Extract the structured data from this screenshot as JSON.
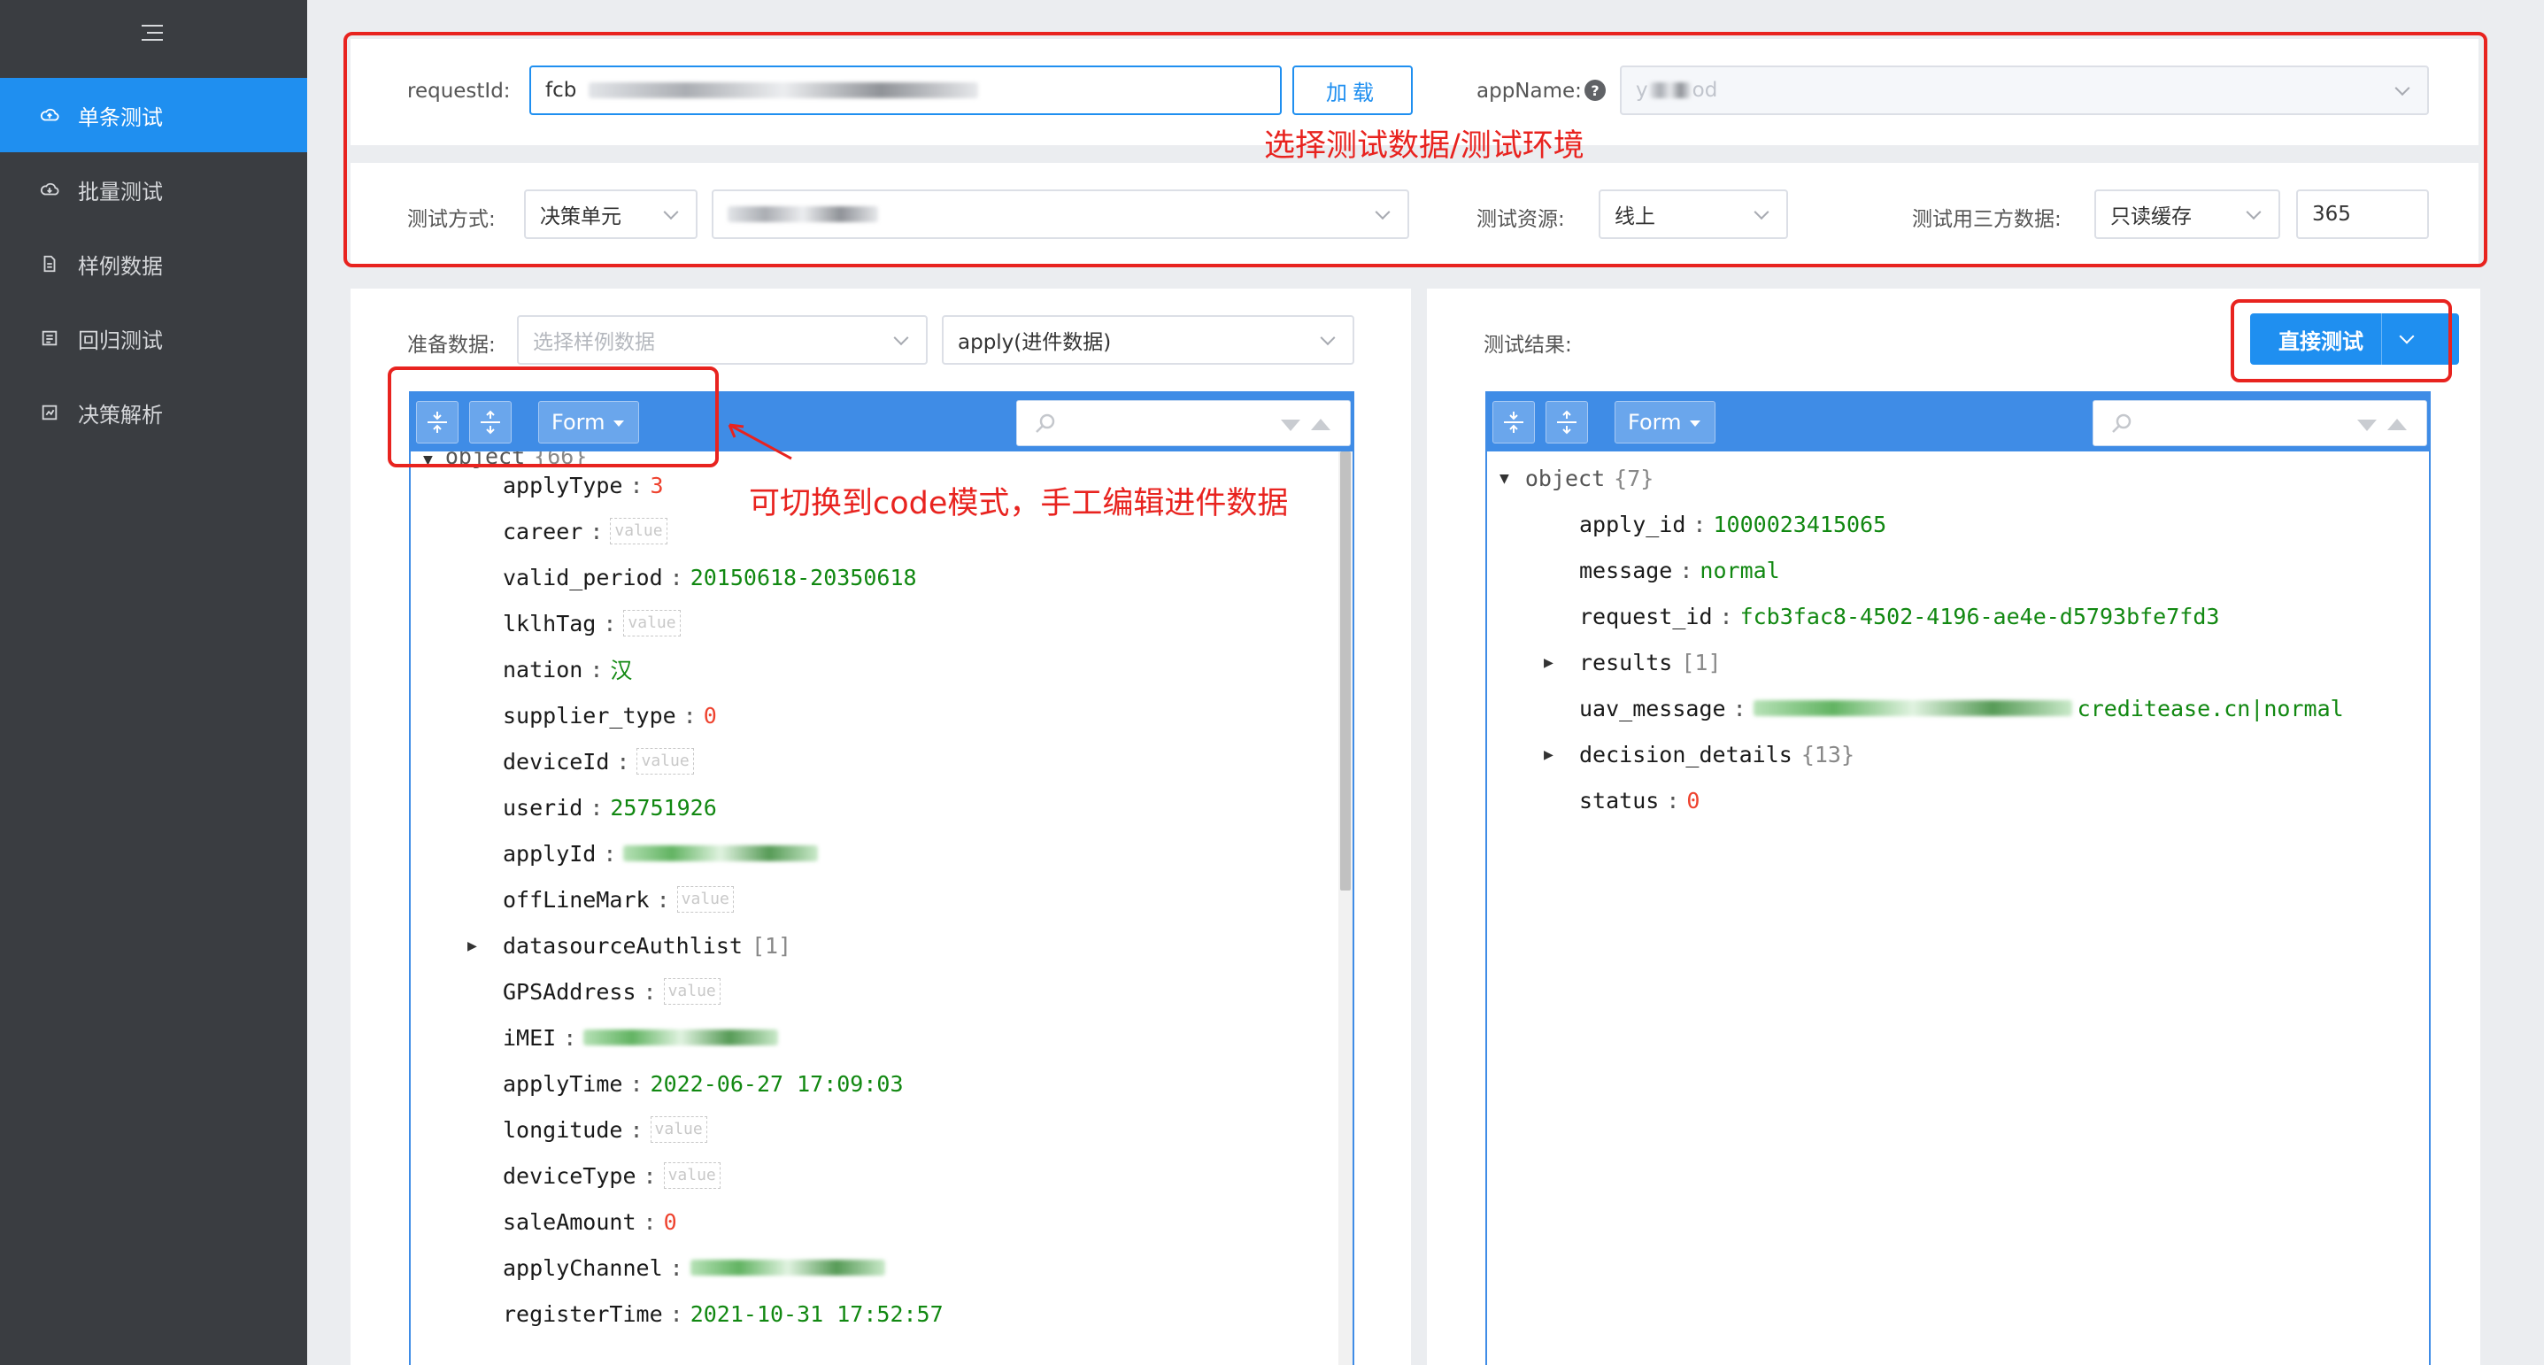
{
  "sidebar": {
    "items": [
      {
        "label": "单条测试",
        "icon": "cloud-upload-icon"
      },
      {
        "label": "批量测试",
        "icon": "cloud-download-icon"
      },
      {
        "label": "样例数据",
        "icon": "document-icon"
      },
      {
        "label": "回归测试",
        "icon": "list-icon"
      },
      {
        "label": "决策解析",
        "icon": "chart-icon"
      }
    ],
    "active_index": 0
  },
  "config": {
    "request_id_label": "requestId:",
    "request_id_value": "fcb",
    "load_button": "加载",
    "app_name_label": "appName:",
    "app_name_value": "y",
    "app_name_suffix": "od",
    "test_mode_label": "测试方式:",
    "test_mode_value": "决策单元",
    "resource_label": "测试资源:",
    "resource_value": "线上",
    "third_party_label": "测试用三方数据:",
    "third_party_value": "只读缓存",
    "days_value": "365"
  },
  "annotations": {
    "top": "选择测试数据/测试环境",
    "editor": "可切换到code模式，手工编辑进件数据"
  },
  "left": {
    "prepare_label": "准备数据:",
    "sample_placeholder": "选择样例数据",
    "data_type_value": "apply(进件数据)",
    "form_button": "Form",
    "root": {
      "label": "object",
      "count": "{66}"
    },
    "rows": [
      {
        "key": "applyType",
        "type": "num",
        "value": "3"
      },
      {
        "key": "career",
        "type": "empty",
        "value": "value"
      },
      {
        "key": "valid_period",
        "type": "str",
        "value": "20150618-20350618"
      },
      {
        "key": "lklhTag",
        "type": "empty",
        "value": "value"
      },
      {
        "key": "nation",
        "type": "str",
        "value": "汉"
      },
      {
        "key": "supplier_type",
        "type": "num",
        "value": "0"
      },
      {
        "key": "deviceId",
        "type": "empty",
        "value": "value"
      },
      {
        "key": "userid",
        "type": "str",
        "value": "25751926"
      },
      {
        "key": "applyId",
        "type": "blur",
        "value": ""
      },
      {
        "key": "offLineMark",
        "type": "empty",
        "value": "value"
      },
      {
        "key": "datasourceAuthlist",
        "type": "array",
        "value": "[1]"
      },
      {
        "key": "GPSAddress",
        "type": "empty",
        "value": "value"
      },
      {
        "key": "iMEI",
        "type": "blur",
        "value": ""
      },
      {
        "key": "applyTime",
        "type": "str",
        "value": "2022-06-27 17:09:03"
      },
      {
        "key": "longitude",
        "type": "empty",
        "value": "value"
      },
      {
        "key": "deviceType",
        "type": "empty",
        "value": "value"
      },
      {
        "key": "saleAmount",
        "type": "num",
        "value": "0"
      },
      {
        "key": "applyChannel",
        "type": "blur",
        "value": ""
      },
      {
        "key": "registerTime",
        "type": "str",
        "value": "2021-10-31 17:52:57"
      }
    ]
  },
  "right": {
    "result_label": "测试结果:",
    "test_button": "直接测试",
    "form_button": "Form",
    "root": {
      "label": "object",
      "count": "{7}"
    },
    "rows": [
      {
        "key": "apply_id",
        "type": "str",
        "value": "1000023415065"
      },
      {
        "key": "message",
        "type": "str",
        "value": "normal"
      },
      {
        "key": "request_id",
        "type": "str",
        "value": "fcb3fac8-4502-4196-ae4e-d5793bfe7fd3"
      },
      {
        "key": "results",
        "type": "array",
        "value": "[1]"
      },
      {
        "key": "uav_message",
        "type": "blur",
        "value": "creditease.cn|normal"
      },
      {
        "key": "decision_details",
        "type": "array",
        "value": "{13}"
      },
      {
        "key": "status",
        "type": "num",
        "value": "0"
      }
    ]
  },
  "colors": {
    "sidebar_bg": "#3a3d41",
    "accent": "#1f8ff0",
    "annotation_red": "#e8231f",
    "editor_blue": "#3f8ce6",
    "string_green": "#118811",
    "number_red": "#ee422e"
  }
}
